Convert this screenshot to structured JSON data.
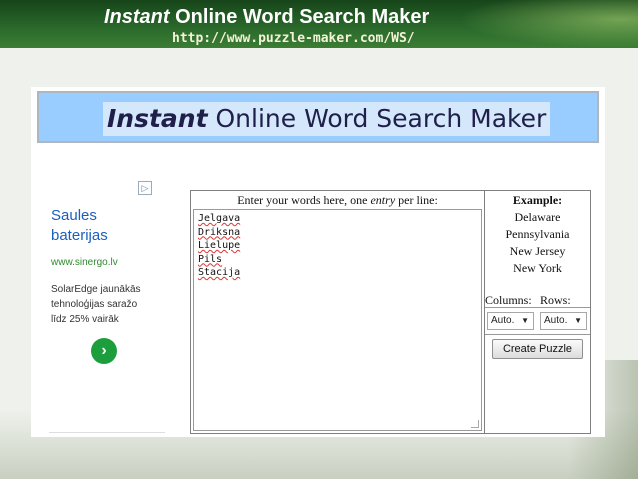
{
  "slide": {
    "title_em": "Instant",
    "title_rest": " Online Word Search Maker",
    "url": "http://www.puzzle-maker.com/WS/"
  },
  "banner": {
    "title_em": "Instant",
    "title_rest": " Online Word Search Maker"
  },
  "ad": {
    "choices_icon": "ad-choices-icon",
    "title": "Saules baterijas",
    "url": "www.sinergo.lv",
    "description": "SolarEdge jaunākās tehnoloģijas saražo līdz 25% vairāk",
    "arrow_icon": "chevron-right-icon",
    "arrow_glyph": "›"
  },
  "words": {
    "header_before": "Enter your words here, one ",
    "header_em": "entry",
    "header_after": " per line:",
    "entries": [
      "Jelgava",
      "Driksna",
      "Lielupe",
      "Pils",
      "Stacija"
    ]
  },
  "example": {
    "title": "Example:",
    "items": [
      "Delaware",
      "Pennsylvania",
      "New Jersey",
      "New York"
    ]
  },
  "options": {
    "columns_label": "Columns:",
    "rows_label": "Rows:",
    "columns_value": "Auto.",
    "rows_value": "Auto.",
    "dropdown_glyph": "▼"
  },
  "create_button": "Create Puzzle",
  "colors": {
    "header_green": "#2b6a2b",
    "banner_blue": "#99ccff",
    "ad_link": "#1a5fbf",
    "ad_url": "#2e8b2e"
  }
}
